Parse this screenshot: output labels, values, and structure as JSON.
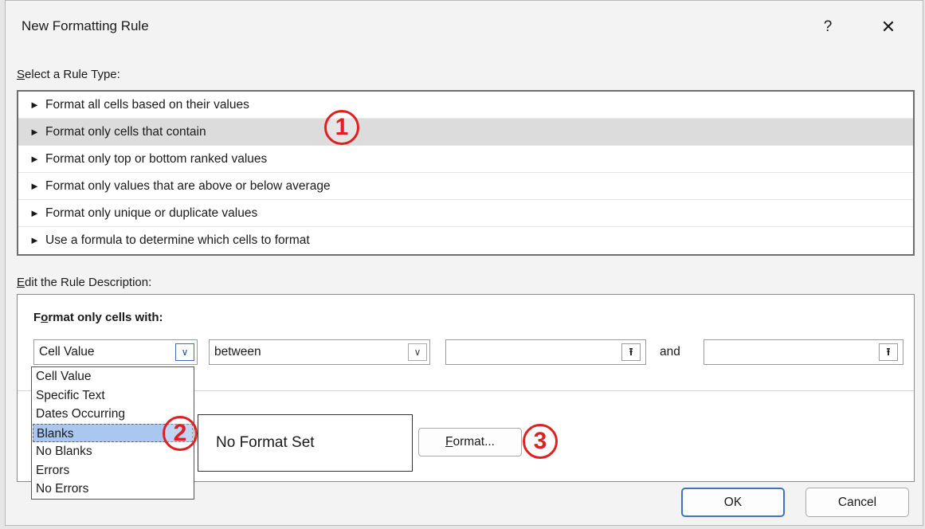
{
  "dialog": {
    "title": "New Formatting Rule",
    "help_glyph": "?",
    "close_glyph": "✕"
  },
  "rule_type": {
    "label_first": "S",
    "label_rest": "elect a Rule Type:",
    "arrow_glyph": "►",
    "items": [
      {
        "label": "Format all cells based on their values"
      },
      {
        "label": "Format only cells that contain",
        "selected": true
      },
      {
        "label": "Format only top or bottom ranked values"
      },
      {
        "label": "Format only values that are above or below average"
      },
      {
        "label": "Format only unique or duplicate values"
      },
      {
        "label": "Use a formula to determine which cells to format"
      }
    ]
  },
  "description": {
    "label_first": "E",
    "label_rest": "dit the Rule Description:",
    "heading_pre": "F",
    "heading_u": "o",
    "heading_rest": "rmat only cells with:",
    "condition_value": "Cell Value",
    "operator_value": "between",
    "and_label": "and",
    "dropdown_options": [
      "Cell Value",
      "Specific Text",
      "Dates Occurring",
      "Blanks",
      "No Blanks",
      "Errors",
      "No Errors"
    ],
    "highlighted_option": "Blanks",
    "preview_text": "No Format Set",
    "format_button_first": "F",
    "format_button_rest": "ormat...",
    "ref_glyph": "⭱",
    "chevron_glyph": "∨"
  },
  "annotations": [
    "1",
    "2",
    "3"
  ],
  "footer": {
    "ok_label": "OK",
    "cancel_label": "Cancel"
  },
  "colors": {
    "annotation": "#e02020",
    "highlight": "#aac7ef",
    "selected_row": "#dcdcdc",
    "default_button_border": "#3c72c7"
  }
}
